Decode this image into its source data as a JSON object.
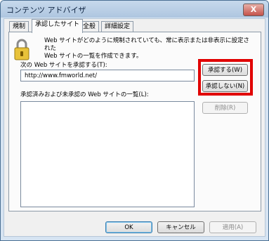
{
  "window": {
    "title": "コンテンツ アドバイザ",
    "close_label": "X"
  },
  "tabs": [
    {
      "label": "規制"
    },
    {
      "label": "承認したサイト"
    },
    {
      "label": "全般"
    },
    {
      "label": "詳細設定"
    }
  ],
  "panel": {
    "description_line1": "Web サイトがどのように規制されていても、常に表示または非表示に設定された",
    "description_line2": "Web サイトの一覧を作成できます。",
    "allow_label": "次の Web サイトを承認する(T):",
    "url_value": "http://www.fmworld.net/",
    "list_label": "承認済みおよび未承認の Web サイトの一覧(L):",
    "always_button": "承認する(W)",
    "never_button": "承認しない(N)",
    "remove_button": "削除(R)"
  },
  "footer": {
    "ok": "OK",
    "cancel": "キャンセル",
    "apply": "適用(A)"
  },
  "colors": {
    "highlight": "#e10000",
    "titlebar": "#b9cfe6"
  }
}
